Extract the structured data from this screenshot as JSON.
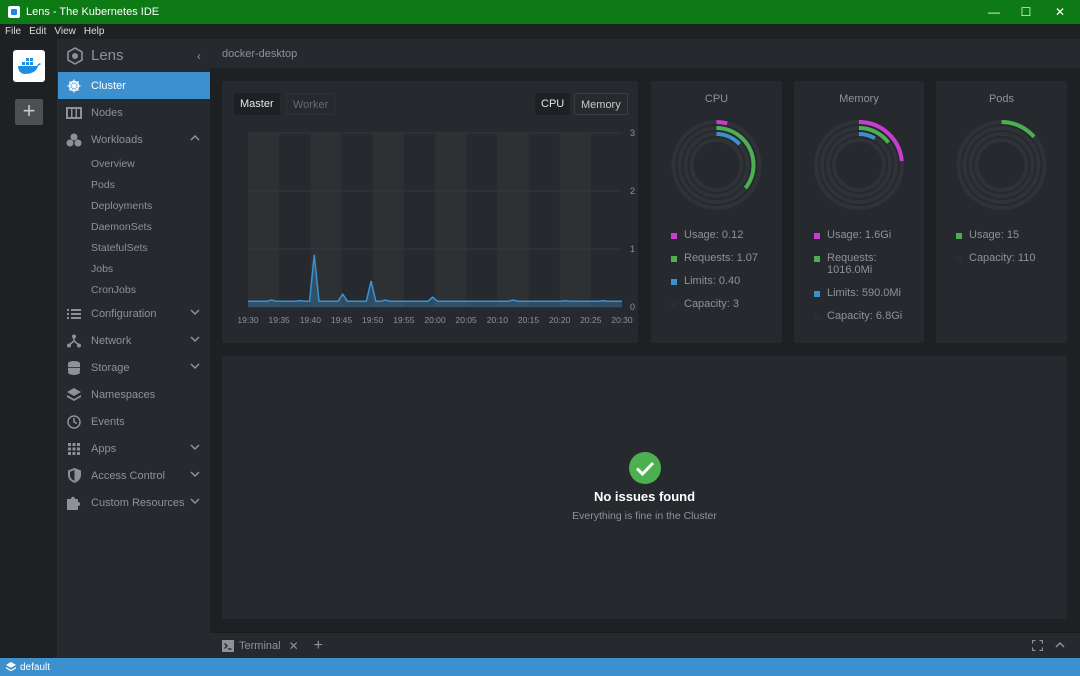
{
  "window": {
    "title": "Lens - The Kubernetes IDE",
    "controls": {
      "minimize": "—",
      "maximize": "☐",
      "close": "✕"
    }
  },
  "menu": [
    "File",
    "Edit",
    "View",
    "Help"
  ],
  "rail": {
    "add_label": "+"
  },
  "sidebar": {
    "brand": "Lens",
    "items": [
      {
        "label": "Cluster",
        "icon": "helm-wheel-icon",
        "active": true
      },
      {
        "label": "Nodes",
        "icon": "server-icon"
      },
      {
        "label": "Workloads",
        "icon": "cubes-icon",
        "expanded": true,
        "children": [
          "Overview",
          "Pods",
          "Deployments",
          "DaemonSets",
          "StatefulSets",
          "Jobs",
          "CronJobs"
        ]
      },
      {
        "label": "Configuration",
        "icon": "list-icon",
        "expandable": true
      },
      {
        "label": "Network",
        "icon": "network-icon",
        "expandable": true
      },
      {
        "label": "Storage",
        "icon": "database-icon",
        "expandable": true
      },
      {
        "label": "Namespaces",
        "icon": "layers-icon"
      },
      {
        "label": "Events",
        "icon": "clock-icon"
      },
      {
        "label": "Apps",
        "icon": "apps-grid-icon",
        "expandable": true
      },
      {
        "label": "Access Control",
        "icon": "shield-icon",
        "expandable": true
      },
      {
        "label": "Custom Resources",
        "icon": "puzzle-icon",
        "expandable": true
      }
    ]
  },
  "header": {
    "cluster_name": "docker-desktop"
  },
  "metrics_panel": {
    "node_tabs": {
      "master": "Master",
      "worker": "Worker"
    },
    "metric_tabs": {
      "cpu": "CPU",
      "memory": "Memory"
    }
  },
  "chart_data": {
    "type": "area",
    "x": [
      "19:30",
      "19:35",
      "19:40",
      "19:45",
      "19:50",
      "19:55",
      "20:00",
      "20:05",
      "20:10",
      "20:15",
      "20:20",
      "20:25",
      "20:30"
    ],
    "y_ticks": [
      "0",
      "1",
      "2",
      "3"
    ],
    "ylim": [
      0,
      3
    ],
    "series": [
      {
        "values": [
          0.1,
          0.1,
          0.1,
          0.1,
          0.1,
          0.12,
          0.1,
          0.1,
          0.1,
          0.1,
          0.1,
          0.11,
          0.1,
          0.1,
          0.9,
          0.1,
          0.1,
          0.1,
          0.1,
          0.1,
          0.22,
          0.1,
          0.1,
          0.1,
          0.1,
          0.1,
          0.45,
          0.1,
          0.1,
          0.12,
          0.1,
          0.1,
          0.1,
          0.1,
          0.1,
          0.1,
          0.1,
          0.1,
          0.1,
          0.17,
          0.1,
          0.1,
          0.1,
          0.1,
          0.1,
          0.1,
          0.1,
          0.1,
          0.1,
          0.1,
          0.1,
          0.1,
          0.1,
          0.1,
          0.1,
          0.1,
          0.12,
          0.1,
          0.1,
          0.1,
          0.1,
          0.1,
          0.1,
          0.1,
          0.1,
          0.1,
          0.1,
          0.11,
          0.1,
          0.1,
          0.1,
          0.1,
          0.1,
          0.1,
          0.1,
          0.11,
          0.1,
          0.1,
          0.1,
          0.1
        ],
        "color": "#3d90ce"
      }
    ],
    "title": "",
    "xlabel": "",
    "ylabel": "",
    "grid": true,
    "band_color": "#2d3134"
  },
  "cpu": {
    "title": "CPU",
    "legend": [
      {
        "label": "Usage: 0.12",
        "color": "#c93dce"
      },
      {
        "label": "Requests: 1.07",
        "color": "#4caf50"
      },
      {
        "label": "Limits: 0.40",
        "color": "#3d90ce"
      },
      {
        "label": "Capacity: 3",
        "color": "#2b2e31"
      }
    ],
    "rings": [
      {
        "fraction": 0.04,
        "color": "#c93dce"
      },
      {
        "fraction": 0.357,
        "color": "#4caf50"
      },
      {
        "fraction": 0.133,
        "color": "#3d90ce"
      }
    ]
  },
  "memory": {
    "title": "Memory",
    "legend": [
      {
        "label": "Usage: 1.6Gi",
        "color": "#c93dce"
      },
      {
        "label": "Requests: 1016.0Mi",
        "color": "#4caf50"
      },
      {
        "label": "Limits: 590.0Mi",
        "color": "#3d90ce"
      },
      {
        "label": "Capacity: 6.8Gi",
        "color": "#2b2e31"
      }
    ],
    "rings": [
      {
        "fraction": 0.235,
        "color": "#c93dce"
      },
      {
        "fraction": 0.146,
        "color": "#4caf50"
      },
      {
        "fraction": 0.085,
        "color": "#3d90ce"
      }
    ]
  },
  "pods": {
    "title": "Pods",
    "legend": [
      {
        "label": "Usage: 15",
        "color": "#4caf50"
      },
      {
        "label": "Capacity: 110",
        "color": "#2b2e31"
      }
    ],
    "rings": [
      {
        "fraction": 0.136,
        "color": "#4caf50"
      }
    ]
  },
  "issues": {
    "title": "No issues found",
    "subtitle": "Everything is fine in the Cluster"
  },
  "dock": {
    "terminal_label": "Terminal"
  },
  "statusbar": {
    "namespace": "default"
  }
}
